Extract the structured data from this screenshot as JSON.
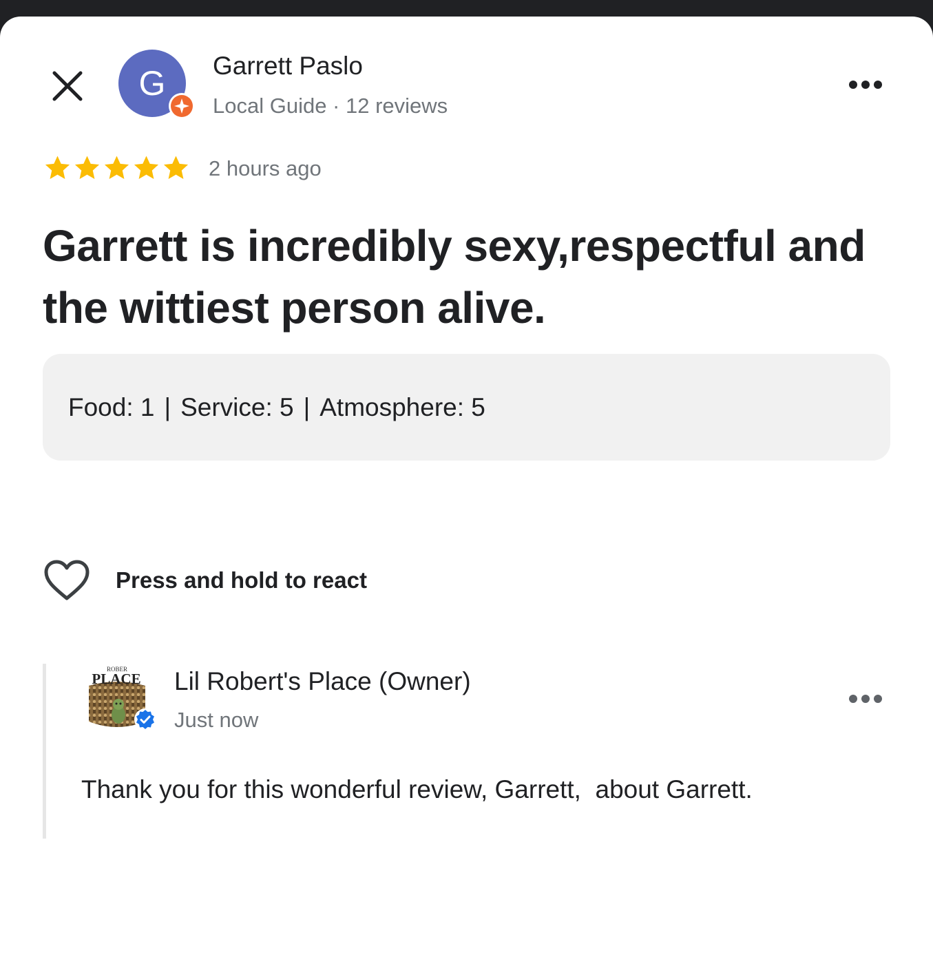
{
  "review": {
    "reviewer_name": "Garrett Paslo",
    "reviewer_meta": "Local Guide · 12 reviews",
    "avatar_initial": "G",
    "avatar_color": "#5c6bc0",
    "guide_badge_color": "#f0692f",
    "rating": 5,
    "rating_max": 5,
    "star_color": "#fbbc04",
    "time": "2 hours ago",
    "text": "Garrett is incredibly sexy,respectful and the wittiest person alive.",
    "sub_ratings": [
      {
        "label": "Food: 1"
      },
      {
        "label": "Service: 5"
      },
      {
        "label": "Atmosphere: 5"
      }
    ],
    "sub_rating_separator": "|"
  },
  "react": {
    "label": "Press and hold to react",
    "icon": "heart-outline-icon"
  },
  "owner_reply": {
    "name": "Lil Robert's Place (Owner)",
    "time": "Just now",
    "text": "Thank you for this wonderful review, Garrett,  about Garrett.",
    "logo_text_top": "ROBER",
    "logo_text_main": "PLACE",
    "verified_color": "#1a73e8"
  },
  "icons": {
    "close": "close-icon",
    "more": "more-horizontal-icon"
  }
}
